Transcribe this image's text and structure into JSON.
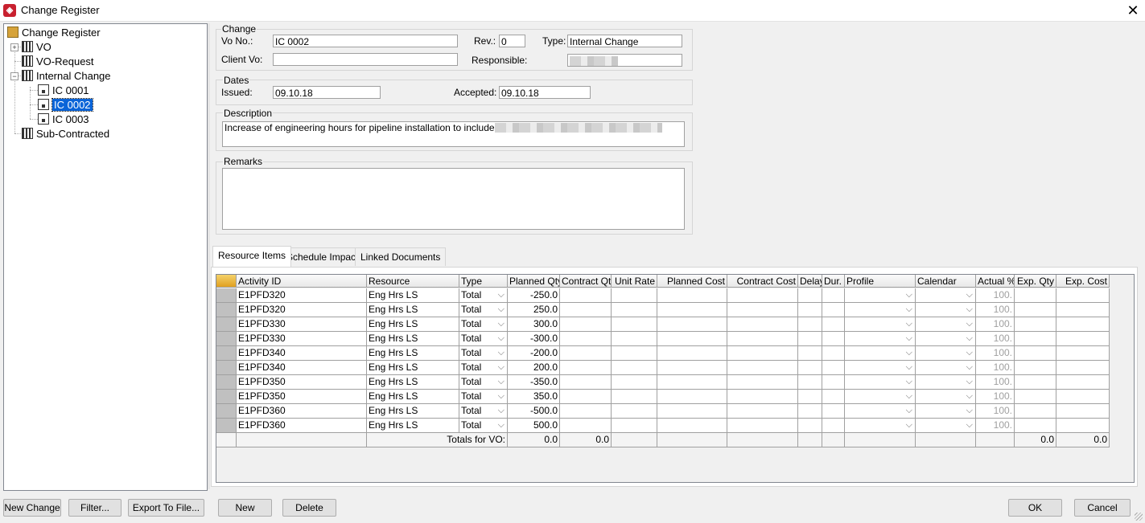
{
  "window": {
    "title": "Change Register",
    "close_glyph": "✕"
  },
  "tree": {
    "root": "Change Register",
    "items": [
      {
        "label": "VO",
        "level": 1
      },
      {
        "label": "VO-Request",
        "level": 1
      },
      {
        "label": "Internal Change",
        "level": 1
      },
      {
        "label": "IC 0001",
        "level": 2
      },
      {
        "label": "IC 0002",
        "level": 2,
        "selected": true
      },
      {
        "label": "IC 0003",
        "level": 2
      },
      {
        "label": "Sub-Contracted",
        "level": 1
      }
    ]
  },
  "change": {
    "group_label": "Change",
    "vo_no_label": "Vo No.:",
    "vo_no_value": "IC 0002",
    "rev_label": "Rev.:",
    "rev_value": "0",
    "type_label": "Type:",
    "type_value": "Internal Change",
    "client_vo_label": "Client Vo:",
    "client_vo_value": "",
    "responsible_label": "Responsible:"
  },
  "dates": {
    "group_label": "Dates",
    "issued_label": "Issued:",
    "issued_value": "09.10.18",
    "accepted_label": "Accepted:",
    "accepted_value": "09.10.18"
  },
  "description": {
    "group_label": "Description",
    "value": "Increase of engineering hours for pipeline installation to include"
  },
  "remarks": {
    "group_label": "Remarks",
    "value": ""
  },
  "tabs": [
    "Resource Items",
    "Schedule Impact",
    "Linked Documents"
  ],
  "grid": {
    "columns": [
      "Activity ID",
      "Resource",
      "Type",
      "Planned Qty",
      "Contract Qty",
      "Unit Rate",
      "Planned Cost",
      "Contract Cost",
      "Delay",
      "Dur.",
      "Profile",
      "Calendar",
      "Actual %",
      "Exp. Qty",
      "Exp. Cost"
    ],
    "rows": [
      {
        "activity": "E1PFD320",
        "resource": "Eng Hrs LS",
        "type": "Total",
        "planned_qty": "-250.0",
        "actual": "100."
      },
      {
        "activity": "E1PFD320",
        "resource": "Eng Hrs LS",
        "type": "Total",
        "planned_qty": "250.0",
        "actual": "100."
      },
      {
        "activity": "E1PFD330",
        "resource": "Eng Hrs LS",
        "type": "Total",
        "planned_qty": "300.0",
        "actual": "100."
      },
      {
        "activity": "E1PFD330",
        "resource": "Eng Hrs LS",
        "type": "Total",
        "planned_qty": "-300.0",
        "actual": "100."
      },
      {
        "activity": "E1PFD340",
        "resource": "Eng Hrs LS",
        "type": "Total",
        "planned_qty": "-200.0",
        "actual": "100."
      },
      {
        "activity": "E1PFD340",
        "resource": "Eng Hrs LS",
        "type": "Total",
        "planned_qty": "200.0",
        "actual": "100."
      },
      {
        "activity": "E1PFD350",
        "resource": "Eng Hrs LS",
        "type": "Total",
        "planned_qty": "-350.0",
        "actual": "100."
      },
      {
        "activity": "E1PFD350",
        "resource": "Eng Hrs LS",
        "type": "Total",
        "planned_qty": "350.0",
        "actual": "100."
      },
      {
        "activity": "E1PFD360",
        "resource": "Eng Hrs LS",
        "type": "Total",
        "planned_qty": "-500.0",
        "actual": "100."
      },
      {
        "activity": "E1PFD360",
        "resource": "Eng Hrs LS",
        "type": "Total",
        "planned_qty": "500.0",
        "actual": "100."
      }
    ],
    "totals": {
      "label": "Totals for VO:",
      "planned_qty": "0.0",
      "contract_qty": "0.0",
      "exp_qty": "0.0",
      "exp_cost": "0.0"
    }
  },
  "buttons": {
    "new_change": "New Change",
    "filter": "Filter...",
    "export": "Export To File...",
    "new": "New",
    "delete": "Delete",
    "ok": "OK",
    "cancel": "Cancel"
  }
}
